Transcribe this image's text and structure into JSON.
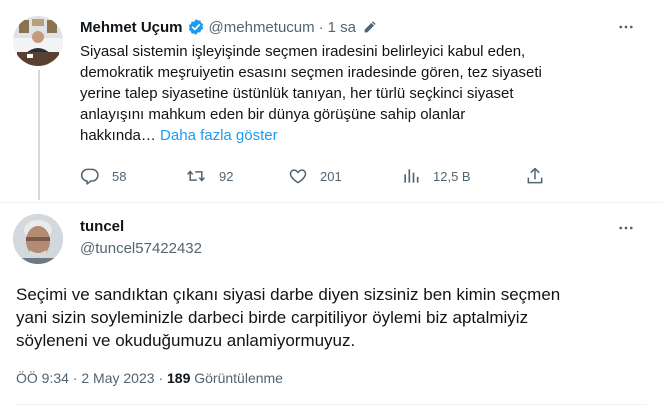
{
  "tweet": {
    "author_name": "Mehmet Uçum",
    "handle": "@mehmetucum",
    "separator": "·",
    "time": "1 sa",
    "text": "Siyasal sistemin işleyişinde seçmen iradesini belirleyici kabul eden,\ndemokratik meşruiyetin esasını seçmen iradesinde gören, tez siyaseti\nyerine talep siyasetine üstünlük tanıyan, her türlü seçkinci siyaset\nanlayışını mahkum eden bir dünya görüşüne sahip olanlar\nhakkında… ",
    "show_more": "Daha fazla göster",
    "replies": "58",
    "retweets": "92",
    "likes": "201",
    "views": "12,5 B"
  },
  "reply": {
    "author_name": "tuncel",
    "handle": "@tuncel57422432",
    "text": "Seçimi ve sandıktan çıkanı siyasi darbe diyen sizsiniz ben kimin seçmen\nyani sizin soyleminizle darbeci birde carpitiliyor öylemi biz aptalmiyiz\nsöyleneni ve okuduğumuzu anlamiyormuyuz.",
    "time": "ÖÖ 9:34",
    "separator": "·",
    "date": "2 May 2023",
    "separator2": "·",
    "views_count": "189",
    "views_label": "Görüntülenme"
  },
  "icons": {
    "verified": "verified-badge-icon",
    "edit": "edit-pencil-icon",
    "more": "more-dots-icon",
    "reply": "reply-bubble-icon",
    "retweet": "retweet-icon",
    "like": "heart-icon",
    "views": "views-chart-icon",
    "share": "share-icon"
  },
  "colors": {
    "accent": "#1d9bf0",
    "muted": "#536471",
    "text": "#0f1419"
  }
}
